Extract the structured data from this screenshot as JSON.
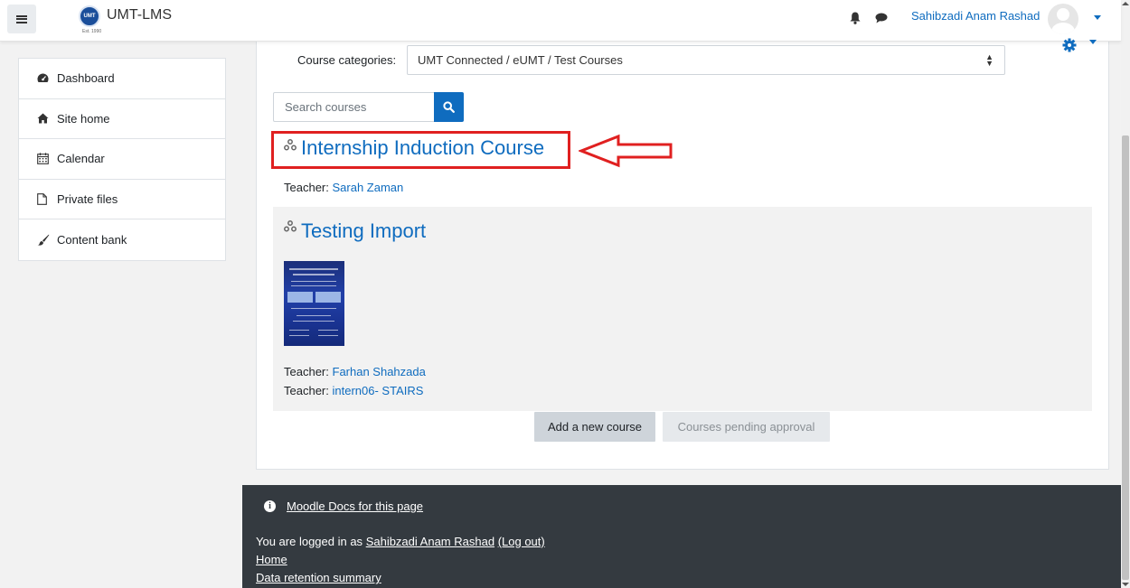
{
  "navbar": {
    "site_name": "UMT-LMS",
    "logo_text": "UMT",
    "logo_sub": "Est. 1990",
    "user_name": "Sahibzadi Anam Rashad"
  },
  "drawer": {
    "items": [
      {
        "label": "Dashboard",
        "icon": "dashboard-icon"
      },
      {
        "label": "Site home",
        "icon": "home-icon"
      },
      {
        "label": "Calendar",
        "icon": "calendar-icon"
      },
      {
        "label": "Private files",
        "icon": "file-icon"
      },
      {
        "label": "Content bank",
        "icon": "paintbrush-icon"
      }
    ]
  },
  "main": {
    "category_label": "Course categories:",
    "category_value": "UMT Connected / eUMT / Test Courses",
    "search_placeholder": "Search courses",
    "courses": [
      {
        "title": "Internship Induction Course",
        "teachers": [
          {
            "label": "Teacher:",
            "name": "Sarah Zaman"
          }
        ]
      },
      {
        "title": "Testing Import",
        "teachers": [
          {
            "label": "Teacher:",
            "name": "Farhan Shahzada"
          },
          {
            "label": "Teacher:",
            "name": "intern06- STAIRS"
          }
        ]
      }
    ],
    "add_course_label": "Add a new course",
    "pending_label": "Courses pending approval"
  },
  "footer": {
    "docs_link": "Moodle Docs for this page",
    "logged_prefix": "You are logged in as",
    "logged_user": "Sahibzadi Anam Rashad",
    "logout": "(Log out)",
    "home": "Home",
    "retention": "Data retention summary"
  },
  "colors": {
    "link": "#0f6cbf",
    "highlight_box": "#e02020",
    "footer_bg": "#343a40"
  }
}
